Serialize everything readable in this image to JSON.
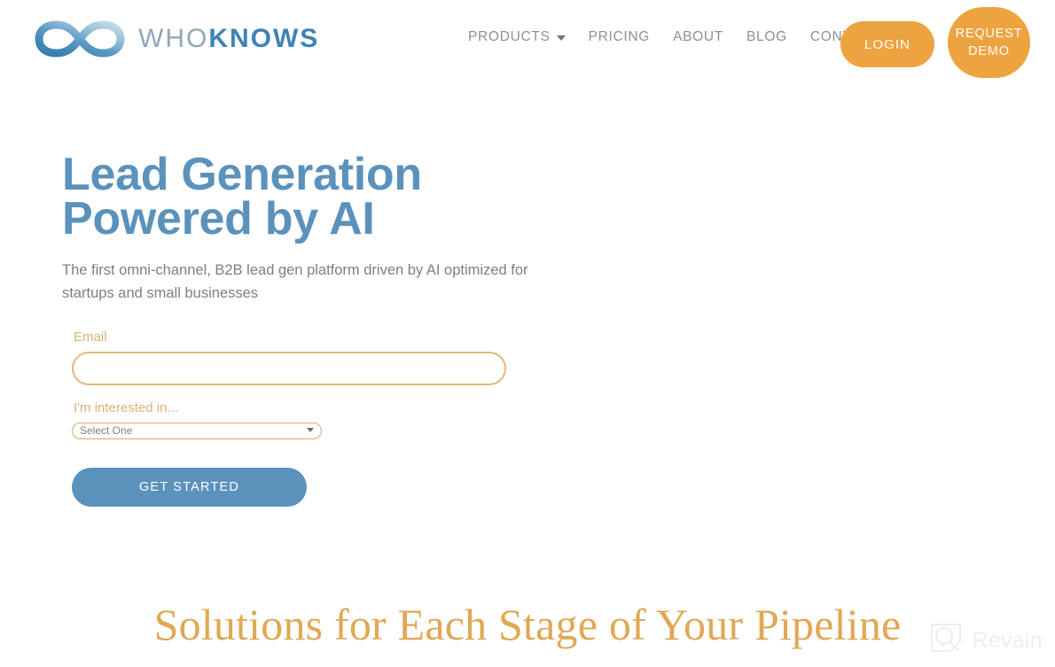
{
  "header": {
    "brand": {
      "logo_icon": "infinity-icon",
      "word_first": "WHO",
      "word_second": "KNOWS"
    },
    "nav": [
      {
        "label": "PRODUCTS",
        "has_dropdown": true,
        "icon": "chevron-down-icon"
      },
      {
        "label": "PRICING",
        "has_dropdown": false
      },
      {
        "label": "ABOUT",
        "has_dropdown": false
      },
      {
        "label": "BLOG",
        "has_dropdown": false
      },
      {
        "label": "CONTACT",
        "has_dropdown": false
      }
    ],
    "login_label": "LOGIN",
    "demo_label_line1": "REQUEST",
    "demo_label_line2": "DEMO"
  },
  "hero": {
    "title_line1": "Lead Generation",
    "title_line2": "Powered by AI",
    "subtitle": "The first omni-channel, B2B lead gen platform driven by AI optimized for startups and small businesses"
  },
  "form": {
    "email_label": "Email",
    "email_value": "",
    "email_placeholder": "",
    "interest_label": "I'm interested in...",
    "interest_selected": "Select One",
    "interest_options": [
      "Select One"
    ],
    "submit_label": "GET STARTED"
  },
  "section": {
    "heading": "Solutions for Each Stage of Your Pipeline"
  },
  "watermark": {
    "text": "Revain",
    "icon": "revain-logo-icon"
  },
  "colors": {
    "accent_orange": "#eda33e",
    "accent_blue": "#5b92bc",
    "label_gold": "#d9b275",
    "heading_gold": "#e0a855",
    "brand_blue": "#3d83b8",
    "brand_light_blue": "#8fa7b6",
    "body_gray": "#7b8084",
    "nav_gray": "#8b9094",
    "background": "#ffffff"
  }
}
